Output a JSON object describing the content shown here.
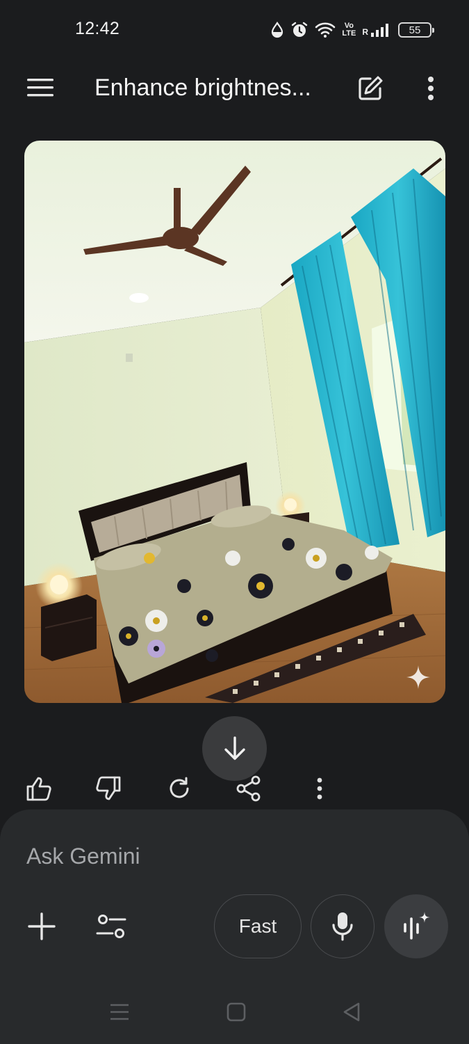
{
  "status_bar": {
    "time": "12:42",
    "icons": [
      "data-saver-icon",
      "alarm-icon",
      "wifi-icon",
      "volte-icon",
      "signal-icon"
    ],
    "volte_top": "Vo",
    "volte_bottom": "LTE",
    "roaming": "R",
    "battery": "55"
  },
  "app_bar": {
    "title": "Enhance brightnes..."
  },
  "image": {
    "description_icon": "sparkle-icon"
  },
  "response_actions": [
    "thumbs-up-icon",
    "thumbs-down-icon",
    "regenerate-icon",
    "share-icon",
    "more-vert-icon"
  ],
  "input": {
    "placeholder": "Ask Gemini",
    "value": "",
    "mode_label": "Fast"
  },
  "colors": {
    "background": "#1b1c1e",
    "panel": "#282a2c",
    "accent_button": "#3b3d40"
  }
}
